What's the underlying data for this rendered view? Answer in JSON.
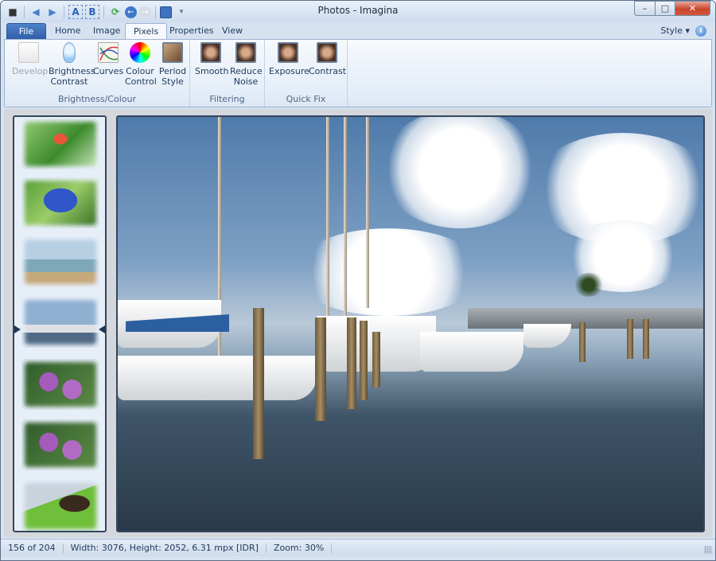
{
  "window": {
    "title": "Photos - Imagina",
    "controls": {
      "minimize": "–",
      "maximize": "□",
      "close": "✕"
    }
  },
  "quick_access": [
    {
      "name": "app-camera-icon",
      "glyph": "📷"
    },
    {
      "name": "previous-icon",
      "glyph": "◀"
    },
    {
      "name": "next-icon",
      "glyph": "▶"
    },
    {
      "name": "compare-a-icon",
      "glyph": "A"
    },
    {
      "name": "compare-b-icon",
      "glyph": "B"
    },
    {
      "name": "refresh-icon",
      "glyph": "⟳"
    },
    {
      "name": "back-icon",
      "glyph": "←"
    },
    {
      "name": "forward-icon",
      "glyph": "→"
    },
    {
      "name": "save-icon",
      "glyph": "💾"
    },
    {
      "name": "customize-icon",
      "glyph": "▾"
    }
  ],
  "tabs": [
    {
      "label": "File"
    },
    {
      "label": "Home"
    },
    {
      "label": "Image"
    },
    {
      "label": "Pixels",
      "active": true
    },
    {
      "label": "Properties"
    },
    {
      "label": "View"
    }
  ],
  "style_menu": {
    "label": "Style ▾"
  },
  "info_button": {
    "label": "i"
  },
  "ribbon": {
    "groups": [
      {
        "label": "Brightness/Colour",
        "buttons": [
          {
            "label": "Develop",
            "disabled": true
          },
          {
            "label": "Brightness Contrast"
          },
          {
            "label": "Curves"
          },
          {
            "label": "Colour Control"
          },
          {
            "label": "Period Style"
          }
        ]
      },
      {
        "label": "Filtering",
        "buttons": [
          {
            "label": "Smooth"
          },
          {
            "label": "Reduce Noise"
          }
        ]
      },
      {
        "label": "Quick Fix",
        "buttons": [
          {
            "label": "Exposure"
          },
          {
            "label": "Contrast"
          }
        ]
      }
    ]
  },
  "thumbnails": [
    {
      "subject": "butterfly on orange flowers"
    },
    {
      "subject": "blue morpho butterfly"
    },
    {
      "subject": "pier over sea"
    },
    {
      "subject": "marina",
      "current": true
    },
    {
      "subject": "purple orchids"
    },
    {
      "subject": "purple orchids"
    },
    {
      "subject": "butterfly on leaf"
    }
  ],
  "viewer": {
    "subject": "marina with sailboats and wooden pilings"
  },
  "status": {
    "position": "156 of 204",
    "dimensions": "Width: 3076, Height: 2052, 6.31 mpx [IDR]",
    "zoom": "Zoom: 30%"
  }
}
